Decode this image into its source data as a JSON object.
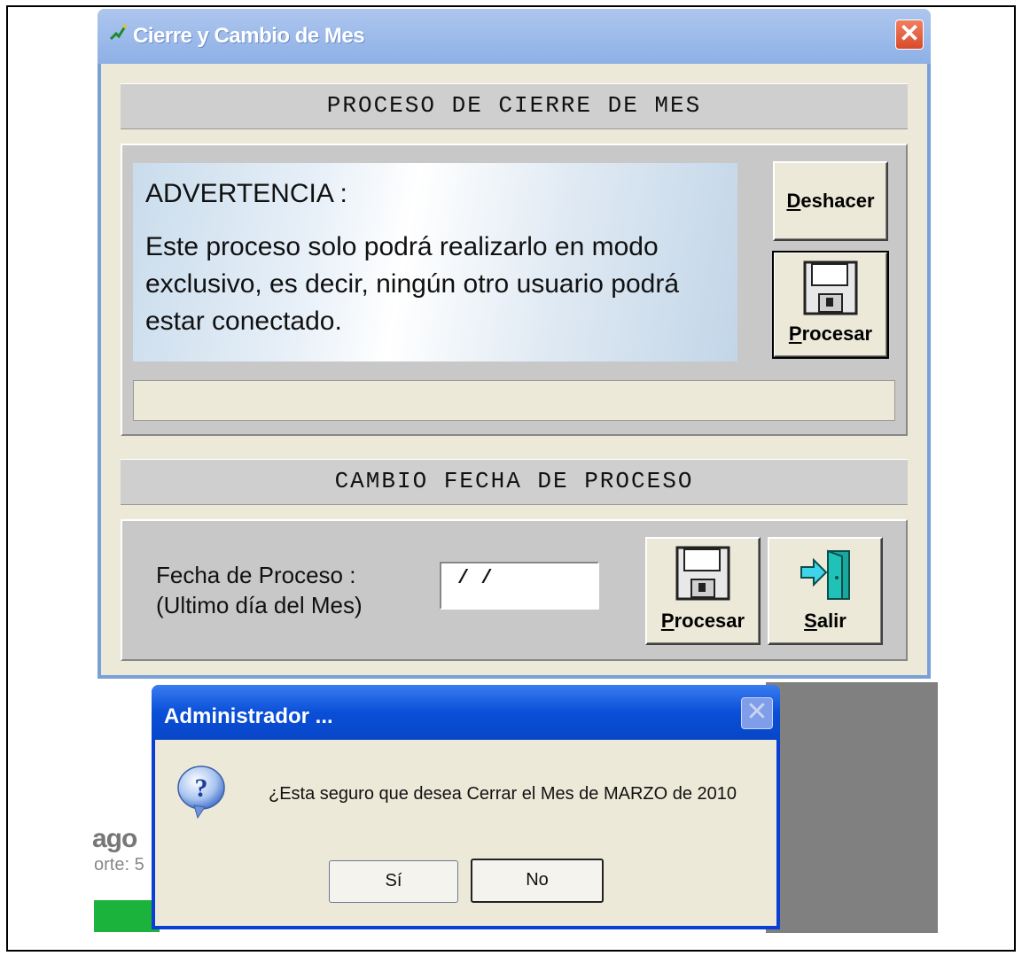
{
  "main_window": {
    "title": "Cierre y Cambio de Mes",
    "close_label": "✕",
    "section_close": "PROCESO DE CIERRE DE MES",
    "warning_title": "ADVERTENCIA :",
    "warning_text": "Este proceso solo podrá realizarlo en modo exclusivo, es decir, ningún otro usuario podrá estar conectado.",
    "undo_button": {
      "underline": "D",
      "rest": "eshacer"
    },
    "process_button_1": {
      "underline": "P",
      "rest": "rocesar",
      "icon": "floppy-disk-icon"
    },
    "section_change": "CAMBIO FECHA DE PROCESO",
    "date_label_line1": "Fecha de Proceso :",
    "date_label_line2": "(Ultimo día del Mes)",
    "date_value": "/ /",
    "process_button_2": {
      "underline": "P",
      "rest": "rocesar",
      "icon": "floppy-disk-icon"
    },
    "exit_button": {
      "underline": "S",
      "rest": "alir",
      "icon": "exit-door-icon"
    }
  },
  "message_box": {
    "title": "Administrador ...",
    "close_label": "✕",
    "icon": "question-icon",
    "message": "¿Esta seguro que desea Cerrar el Mes de MARZO de 2010",
    "yes_label": "Sí",
    "no_label": "No"
  },
  "background": {
    "text1": "ago",
    "text2": "orte: 5"
  }
}
